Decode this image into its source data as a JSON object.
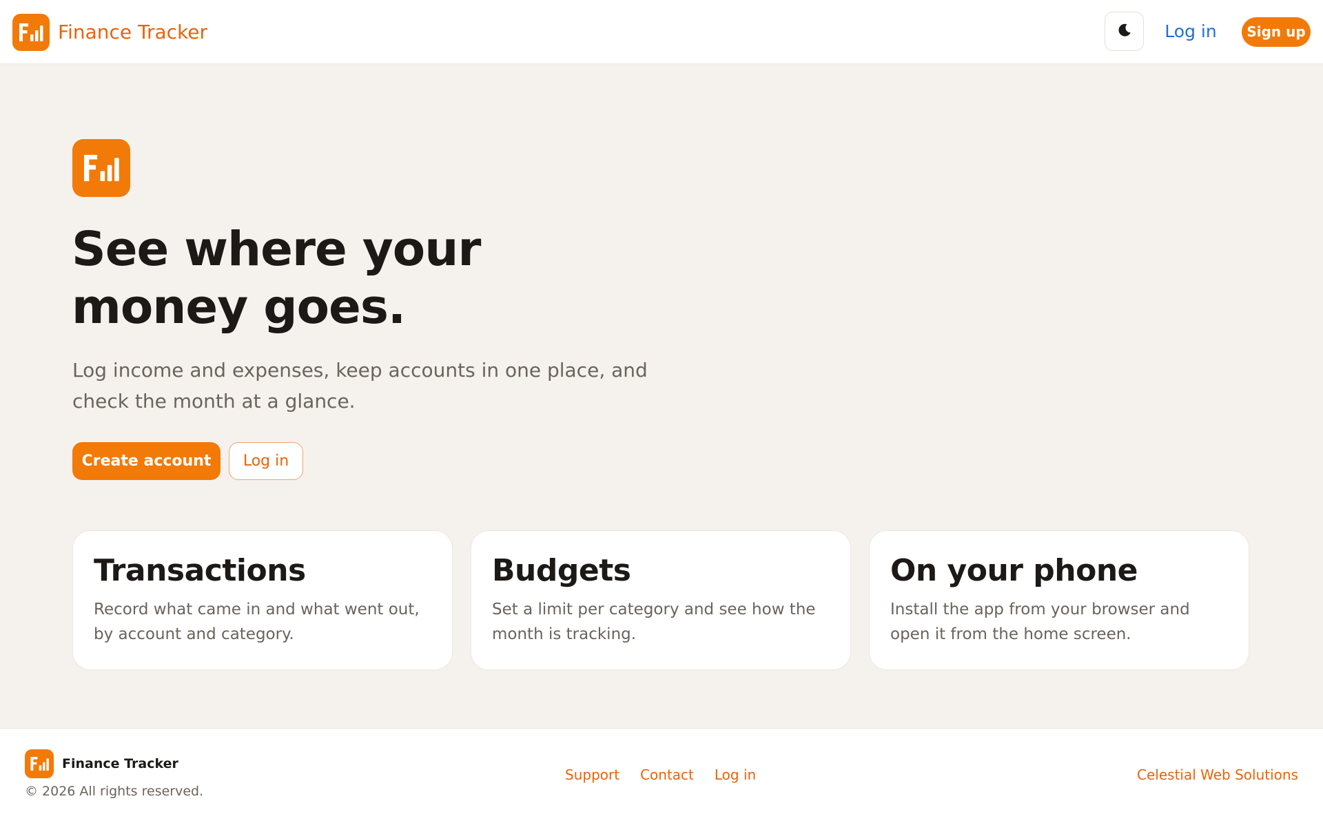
{
  "header": {
    "brand_name": "Finance Tracker",
    "logo_icon": "finance-tracker-logo-icon",
    "theme_toggle_icon": "moon-icon",
    "login_label": "Log in",
    "signup_label": "Sign up"
  },
  "hero": {
    "title_line_1": "See where your",
    "title_line_2": "money goes.",
    "subtitle_line_1": "Log income and expenses, keep accounts in one place, and",
    "subtitle_line_2": "check the month at a glance.",
    "create_account_label": "Create account",
    "login_label": "Log in"
  },
  "features": [
    {
      "title": "Transactions",
      "text_line_1": "Record what came in and what went out,",
      "text_line_2": "by account and category."
    },
    {
      "title": "Budgets",
      "text_line_1": "Set a limit per category and see how the",
      "text_line_2": "month is tracking."
    },
    {
      "title": "On your phone",
      "text_line_1": "Install the app from your browser and",
      "text_line_2": "open it from the home screen."
    }
  ],
  "footer": {
    "brand_name": "Finance Tracker",
    "copyright": "© 2026 All rights reserved.",
    "links": [
      "Support",
      "Contact",
      "Log in"
    ],
    "credit": "Celestial Web Solutions"
  },
  "colors": {
    "accent": "#f27a08",
    "accent_text": "#e8630a",
    "link_blue": "#1f6fd6",
    "page_background": "#f5f2ee",
    "heading": "#1c1917",
    "muted_text": "#6b635c"
  }
}
